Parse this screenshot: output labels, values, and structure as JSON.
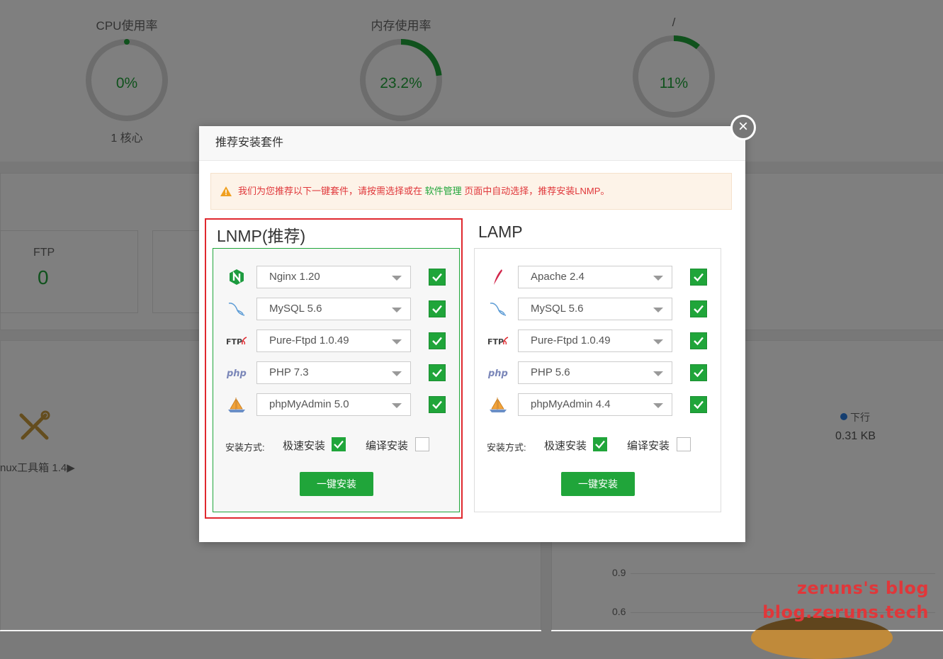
{
  "dashboard": {
    "gauges": [
      {
        "title": "CPU使用率",
        "value": "0%",
        "sub": "1 核心",
        "percent": 0
      },
      {
        "title": "内存使用率",
        "value": "23.2%",
        "sub": "",
        "percent": 23.2
      },
      {
        "title": "/",
        "value": "11%",
        "sub": "",
        "percent": 11
      }
    ],
    "ftp": {
      "label": "FTP",
      "value": "0"
    },
    "toolbox_label": "nux工具箱 1.4▶",
    "traffic": {
      "label": "下行",
      "value": "0.31 KB"
    },
    "axis_ticks": [
      "0.9",
      "0.6"
    ]
  },
  "modal": {
    "title": "推荐安装套件",
    "close_symbol": "×",
    "notice": {
      "before": "我们为您推荐以下一键套件，请按需选择或在 ",
      "link": "软件管理",
      "after": " 页面中自动选择，推荐安装LNMP。"
    },
    "suites": [
      {
        "title": "LNMP(推荐)",
        "items": [
          {
            "icon": "nginx-icon",
            "value": "Nginx 1.20",
            "checked": true
          },
          {
            "icon": "mysql-icon",
            "value": "MySQL 5.6",
            "checked": true
          },
          {
            "icon": "ftp-icon",
            "value": "Pure-Ftpd 1.0.49",
            "checked": true
          },
          {
            "icon": "php-icon",
            "value": "PHP 7.3",
            "checked": true
          },
          {
            "icon": "phpmyadmin-icon",
            "value": "phpMyAdmin 5.0",
            "checked": true
          }
        ],
        "method_label": "安装方式:",
        "fast_label": "极速安装",
        "compile_label": "编译安装",
        "fast_checked": true,
        "compile_checked": false,
        "button": "一键安装"
      },
      {
        "title": "LAMP",
        "items": [
          {
            "icon": "apache-icon",
            "value": "Apache 2.4",
            "checked": true
          },
          {
            "icon": "mysql-icon",
            "value": "MySQL 5.6",
            "checked": true
          },
          {
            "icon": "ftp-icon",
            "value": "Pure-Ftpd 1.0.49",
            "checked": true
          },
          {
            "icon": "php-icon",
            "value": "PHP 5.6",
            "checked": true
          },
          {
            "icon": "phpmyadmin-icon",
            "value": "phpMyAdmin 4.4",
            "checked": true
          }
        ],
        "method_label": "安装方式:",
        "fast_label": "极速安装",
        "compile_label": "编译安装",
        "fast_checked": true,
        "compile_checked": false,
        "button": "一键安装"
      }
    ]
  },
  "watermark": [
    "zeruns's blog",
    "blog.zeruns.tech"
  ],
  "colors": {
    "accent": "#20a53a",
    "warning_text": "#e0373a",
    "highlight": "#e0282e"
  }
}
